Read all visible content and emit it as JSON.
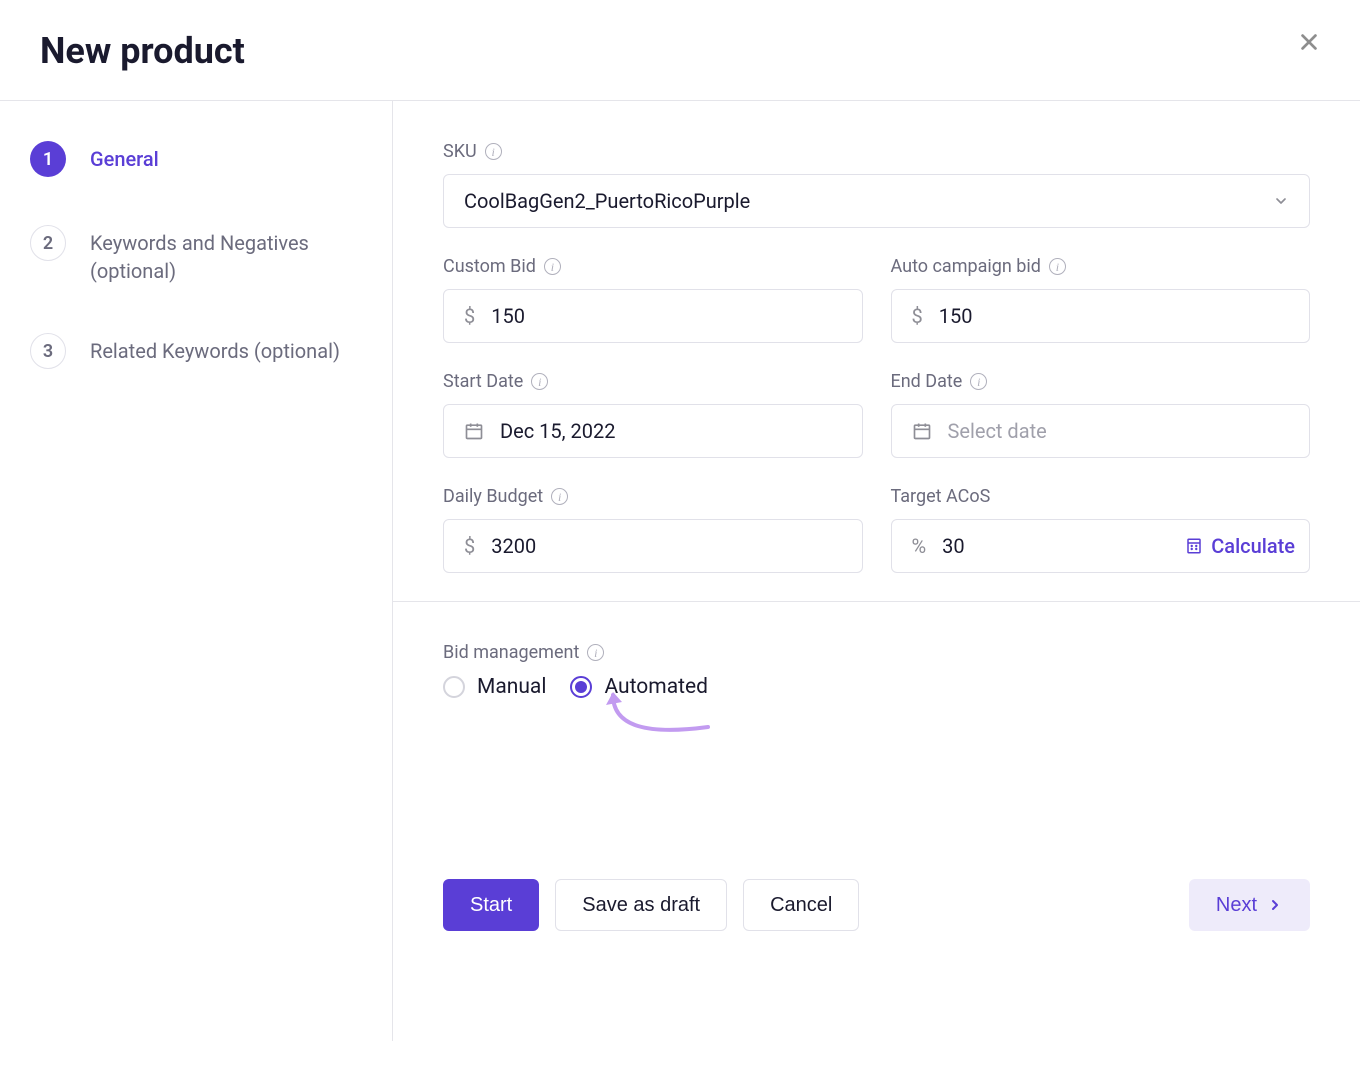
{
  "header": {
    "title": "New product"
  },
  "sidebar": {
    "steps": [
      {
        "num": "1",
        "label": "General",
        "active": true
      },
      {
        "num": "2",
        "label": "Keywords and Negatives (optional)",
        "active": false
      },
      {
        "num": "3",
        "label": "Related Keywords (optional)",
        "active": false
      }
    ]
  },
  "form": {
    "sku": {
      "label": "SKU",
      "value": "CoolBagGen2_PuertoRicoPurple"
    },
    "custom_bid": {
      "label": "Custom Bid",
      "prefix": "$",
      "value": "150"
    },
    "auto_bid": {
      "label": "Auto campaign bid",
      "prefix": "$",
      "value": "150"
    },
    "start_date": {
      "label": "Start Date",
      "value": "Dec 15, 2022"
    },
    "end_date": {
      "label": "End Date",
      "placeholder": "Select date"
    },
    "daily_budget": {
      "label": "Daily Budget",
      "prefix": "$",
      "value": "3200"
    },
    "target_acos": {
      "label": "Target ACoS",
      "prefix": "%",
      "value": "30",
      "action": "Calculate"
    },
    "bid_management": {
      "label": "Bid management",
      "options": {
        "manual": "Manual",
        "automated": "Automated"
      },
      "selected": "automated"
    }
  },
  "buttons": {
    "start": "Start",
    "save_draft": "Save as draft",
    "cancel": "Cancel",
    "next": "Next"
  },
  "colors": {
    "accent": "#5a3ed6",
    "annotation": "#c29bf0"
  }
}
